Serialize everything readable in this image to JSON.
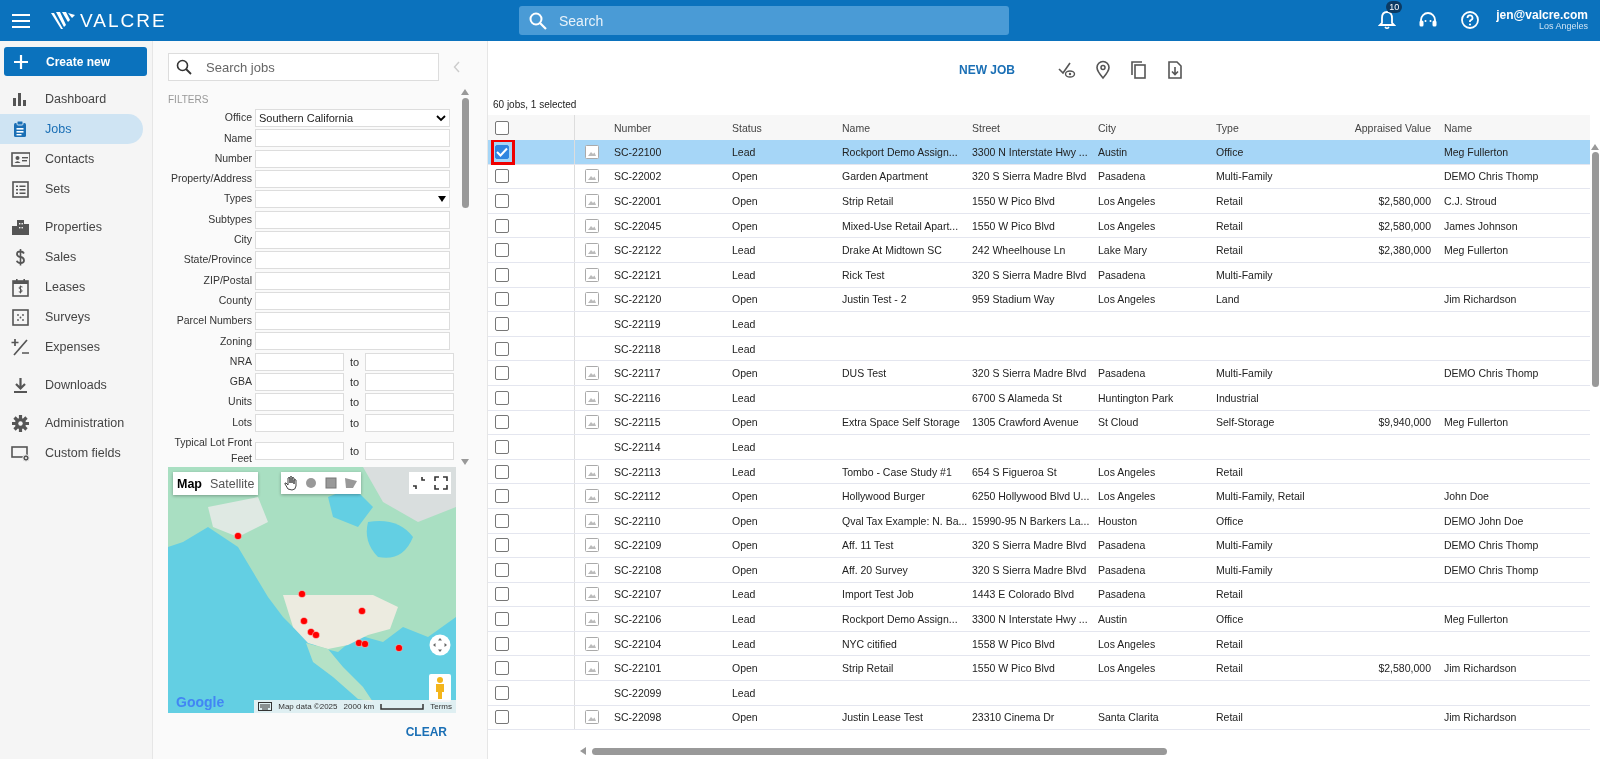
{
  "topbar": {
    "brand": "VALCRE",
    "search": {
      "placeholder": "Search"
    },
    "notifications": "10",
    "user": {
      "email": "jen@valcre.com",
      "location": "Los Angeles"
    }
  },
  "sidebar": {
    "create": "Create new",
    "groups": [
      [
        {
          "label": "Dashboard",
          "selected": false
        },
        {
          "label": "Jobs",
          "selected": true
        },
        {
          "label": "Contacts",
          "selected": false
        },
        {
          "label": "Sets",
          "selected": false
        }
      ],
      [
        {
          "label": "Properties",
          "selected": false
        },
        {
          "label": "Sales",
          "selected": false
        },
        {
          "label": "Leases",
          "selected": false
        },
        {
          "label": "Surveys",
          "selected": false
        },
        {
          "label": "Expenses",
          "selected": false
        }
      ],
      [
        {
          "label": "Downloads",
          "selected": false
        }
      ],
      [
        {
          "label": "Administration",
          "selected": false
        },
        {
          "label": "Custom fields",
          "selected": false
        }
      ]
    ]
  },
  "filters_panel": {
    "search": {
      "placeholder": "Search jobs"
    },
    "heading": "FILTERS",
    "filters": [
      {
        "label": "Office",
        "kind": "select",
        "value": "Southern California"
      },
      {
        "label": "Name",
        "kind": "text"
      },
      {
        "label": "Number",
        "kind": "text"
      },
      {
        "label": "Property/Address",
        "kind": "text"
      },
      {
        "label": "Types",
        "kind": "dropdown"
      },
      {
        "label": "Subtypes",
        "kind": "text"
      },
      {
        "label": "City",
        "kind": "text"
      },
      {
        "label": "State/Province",
        "kind": "text"
      },
      {
        "label": "ZIP/Postal",
        "kind": "text"
      },
      {
        "label": "County",
        "kind": "text"
      },
      {
        "label": "Parcel Numbers",
        "kind": "text"
      },
      {
        "label": "Zoning",
        "kind": "text"
      },
      {
        "label": "NRA",
        "kind": "range",
        "separator": "to"
      },
      {
        "label": "GBA",
        "kind": "range",
        "separator": "to"
      },
      {
        "label": "Units",
        "kind": "range",
        "separator": "to"
      },
      {
        "label": "Lots",
        "kind": "range",
        "separator": "to"
      },
      {
        "label": "Typical Lot Front Feet",
        "kind": "range",
        "separator": "to"
      }
    ],
    "map": {
      "kind": "picture",
      "map_types": [
        {
          "label": "Map",
          "selected": true
        },
        {
          "label": "Satellite",
          "selected": false
        }
      ],
      "logo": "Google",
      "attribution": "Map data ©2025",
      "scale": "2000 km",
      "terms": "Terms"
    },
    "clear": "CLEAR"
  },
  "toolbar": {
    "new_job": "NEW JOB"
  },
  "summary": "60 jobs, 1 selected",
  "table": {
    "select_all_checked": false,
    "columns": [
      "Number",
      "Status",
      "Name",
      "Street",
      "City",
      "Type",
      "Appraised Value",
      "Name"
    ],
    "rows": [
      {
        "selected": true,
        "checked": true,
        "highlighted": true,
        "image": true,
        "cells": [
          "SC-22100",
          "Lead",
          "Rockport Demo Assign...",
          "3300 N Interstate Hwy ...",
          "Austin",
          "Office",
          "",
          "Meg Fullerton"
        ]
      },
      {
        "selected": false,
        "checked": false,
        "highlighted": false,
        "image": true,
        "cells": [
          "SC-22002",
          "Open",
          "Garden Apartment",
          "320 S Sierra Madre Blvd",
          "Pasadena",
          "Multi-Family",
          "",
          "DEMO Chris Thomp"
        ]
      },
      {
        "selected": false,
        "checked": false,
        "highlighted": false,
        "image": true,
        "cells": [
          "SC-22001",
          "Open",
          "Strip Retail",
          "1550 W Pico Blvd",
          "Los Angeles",
          "Retail",
          "$2,580,000",
          "C.J. Stroud"
        ]
      },
      {
        "selected": false,
        "checked": false,
        "highlighted": false,
        "image": true,
        "cells": [
          "SC-22045",
          "Open",
          "Mixed-Use Retail Apart...",
          "1550 W Pico Blvd",
          "Los Angeles",
          "Retail",
          "$2,580,000",
          "James Johnson"
        ]
      },
      {
        "selected": false,
        "checked": false,
        "highlighted": false,
        "image": true,
        "cells": [
          "SC-22122",
          "Lead",
          "Drake At Midtown SC",
          "242 Wheelhouse Ln",
          "Lake Mary",
          "Retail",
          "$2,380,000",
          "Meg Fullerton"
        ]
      },
      {
        "selected": false,
        "checked": false,
        "highlighted": false,
        "image": true,
        "cells": [
          "SC-22121",
          "Lead",
          "Rick Test",
          "320 S Sierra Madre Blvd",
          "Pasadena",
          "Multi-Family",
          "",
          ""
        ]
      },
      {
        "selected": false,
        "checked": false,
        "highlighted": false,
        "image": true,
        "cells": [
          "SC-22120",
          "Open",
          "Justin Test - 2",
          "959 Stadium Way",
          "Los Angeles",
          "Land",
          "",
          "Jim Richardson"
        ]
      },
      {
        "selected": false,
        "checked": false,
        "highlighted": false,
        "image": false,
        "cells": [
          "SC-22119",
          "Lead",
          "",
          "",
          "",
          "",
          "",
          ""
        ]
      },
      {
        "selected": false,
        "checked": false,
        "highlighted": false,
        "image": false,
        "cells": [
          "SC-22118",
          "Lead",
          "",
          "",
          "",
          "",
          "",
          ""
        ]
      },
      {
        "selected": false,
        "checked": false,
        "highlighted": false,
        "image": true,
        "cells": [
          "SC-22117",
          "Open",
          "DUS Test",
          "320 S Sierra Madre Blvd",
          "Pasadena",
          "Multi-Family",
          "",
          "DEMO Chris Thomp"
        ]
      },
      {
        "selected": false,
        "checked": false,
        "highlighted": false,
        "image": true,
        "cells": [
          "SC-22116",
          "Lead",
          "",
          "6700 S Alameda St",
          "Huntington Park",
          "Industrial",
          "",
          ""
        ]
      },
      {
        "selected": false,
        "checked": false,
        "highlighted": false,
        "image": true,
        "cells": [
          "SC-22115",
          "Open",
          "Extra Space Self Storage",
          "1305 Crawford Avenue",
          "St Cloud",
          "Self-Storage",
          "$9,940,000",
          "Meg Fullerton"
        ]
      },
      {
        "selected": false,
        "checked": false,
        "highlighted": false,
        "image": false,
        "cells": [
          "SC-22114",
          "Lead",
          "",
          "",
          "",
          "",
          "",
          ""
        ]
      },
      {
        "selected": false,
        "checked": false,
        "highlighted": false,
        "image": true,
        "cells": [
          "SC-22113",
          "Lead",
          "Tombo - Case Study #1",
          "654 S Figueroa St",
          "Los Angeles",
          "Retail",
          "",
          ""
        ]
      },
      {
        "selected": false,
        "checked": false,
        "highlighted": false,
        "image": true,
        "cells": [
          "SC-22112",
          "Open",
          "Hollywood Burger",
          "6250 Hollywood Blvd U...",
          "Los Angeles",
          "Multi-Family, Retail",
          "",
          "John Doe"
        ]
      },
      {
        "selected": false,
        "checked": false,
        "highlighted": false,
        "image": true,
        "cells": [
          "SC-22110",
          "Open",
          "Qval Tax Example: N. Ba...",
          "15990-95 N Barkers La...",
          "Houston",
          "Office",
          "",
          "DEMO John Doe"
        ]
      },
      {
        "selected": false,
        "checked": false,
        "highlighted": false,
        "image": true,
        "cells": [
          "SC-22109",
          "Open",
          "Aff. 11 Test",
          "320 S Sierra Madre Blvd",
          "Pasadena",
          "Multi-Family",
          "",
          "DEMO Chris Thomp"
        ]
      },
      {
        "selected": false,
        "checked": false,
        "highlighted": false,
        "image": true,
        "cells": [
          "SC-22108",
          "Open",
          "Aff. 20 Survey",
          "320 S Sierra Madre Blvd",
          "Pasadena",
          "Multi-Family",
          "",
          "DEMO Chris Thomp"
        ]
      },
      {
        "selected": false,
        "checked": false,
        "highlighted": false,
        "image": true,
        "cells": [
          "SC-22107",
          "Lead",
          "Import Test Job",
          "1443 E Colorado Blvd",
          "Pasadena",
          "Retail",
          "",
          ""
        ]
      },
      {
        "selected": false,
        "checked": false,
        "highlighted": false,
        "image": true,
        "cells": [
          "SC-22106",
          "Lead",
          "Rockport Demo Assign...",
          "3300 N Interstate Hwy ...",
          "Austin",
          "Office",
          "",
          "Meg Fullerton"
        ]
      },
      {
        "selected": false,
        "checked": false,
        "highlighted": false,
        "image": true,
        "cells": [
          "SC-22104",
          "Lead",
          "NYC citified",
          "1558 W Pico Blvd",
          "Los Angeles",
          "Retail",
          "",
          ""
        ]
      },
      {
        "selected": false,
        "checked": false,
        "highlighted": false,
        "image": true,
        "cells": [
          "SC-22101",
          "Open",
          "Strip Retail",
          "1550 W Pico Blvd",
          "Los Angeles",
          "Retail",
          "$2,580,000",
          "Jim Richardson"
        ]
      },
      {
        "selected": false,
        "checked": false,
        "highlighted": false,
        "image": false,
        "cells": [
          "SC-22099",
          "Lead",
          "",
          "",
          "",
          "",
          "",
          ""
        ]
      },
      {
        "selected": false,
        "checked": false,
        "highlighted": false,
        "image": true,
        "cells": [
          "SC-22098",
          "Open",
          "Justin Lease Test",
          "23310 Cinema Dr",
          "Santa Clarita",
          "Retail",
          "",
          "Jim Richardson"
        ]
      }
    ]
  }
}
